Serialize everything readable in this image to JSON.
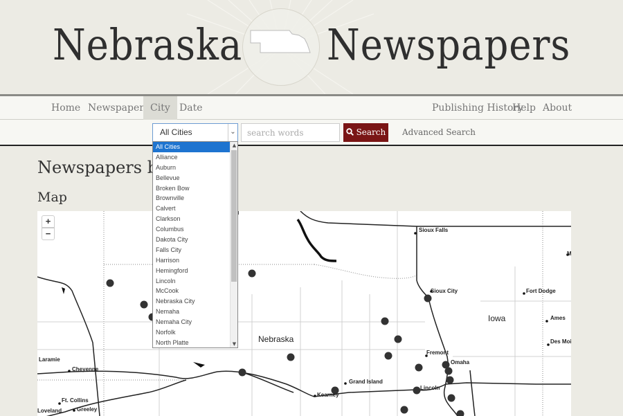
{
  "masthead": {
    "title_left": "Nebraska",
    "title_right": "Newspapers"
  },
  "nav": {
    "left": [
      "Home",
      "Newspapers",
      "City",
      "Date"
    ],
    "right": [
      "Publishing History",
      "Help",
      "About"
    ],
    "active": "City"
  },
  "search": {
    "city_value": "All Cities",
    "placeholder": "search words",
    "button_label": "Search",
    "advanced_label": "Advanced Search"
  },
  "dropdown": {
    "options": [
      "All Cities",
      "Alliance",
      "Auburn",
      "Bellevue",
      "Broken Bow",
      "Brownville",
      "Calvert",
      "Clarkson",
      "Columbus",
      "Dakota City",
      "Falls City",
      "Harrison",
      "Hemingford",
      "Lincoln",
      "McCook",
      "Nebraska City",
      "Nemaha",
      "Nemaha City",
      "Norfolk",
      "North Platte"
    ],
    "selected": "All Cities"
  },
  "page": {
    "heading": "Newspapers by City",
    "subheading": "Map"
  },
  "map": {
    "zoom_in": "+",
    "zoom_out": "−",
    "labels": [
      "Sioux Falls",
      "Sioux City",
      "Fort Dodge",
      "Iowa",
      "Ames",
      "Des Moines",
      "Nebraska",
      "Fremont",
      "Omaha",
      "Grand Island",
      "Lincoln",
      "Kearney",
      "Laramie",
      "Cheyenne",
      "Ft. Collins",
      "Greeley",
      "Loveland",
      "M"
    ]
  },
  "colors": {
    "search_button": "#7a1515",
    "selected_option": "#1e74d0",
    "background": "#ecebe4"
  }
}
